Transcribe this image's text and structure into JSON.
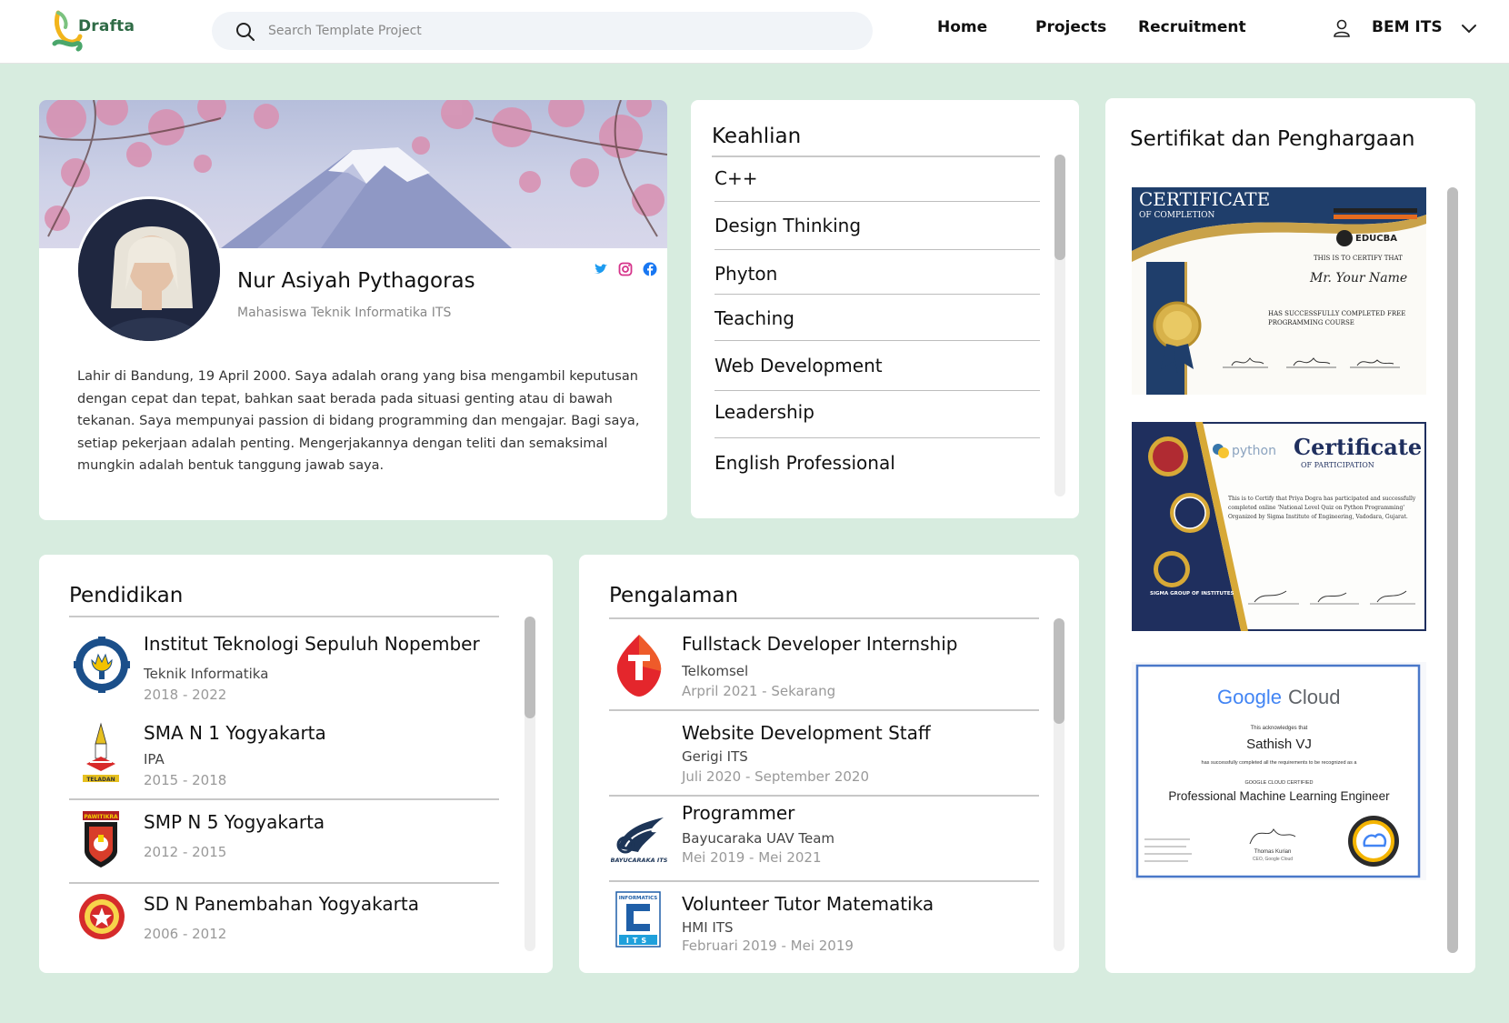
{
  "nav": {
    "logo_text": "Drafta",
    "search_placeholder": "Search Template Project",
    "links": [
      "Home",
      "Projects",
      "Recruitment"
    ],
    "user_name": "BEM ITS"
  },
  "profile": {
    "name": "Nur Asiyah Pythagoras",
    "role": "Mahasiswa Teknik Informatika ITS",
    "bio": "Lahir di Bandung, 19 April 2000. Saya adalah orang yang bisa mengambil keputusan dengan cepat dan tepat, bahkan saat berada pada situasi genting atau di bawah tekanan. Saya mempunyai passion di bidang programming dan mengajar. Bagi saya, setiap pekerjaan adalah penting. Mengerjakannya dengan teliti dan semaksimal mungkin adalah bentuk tanggung jawab saya.",
    "social_icons": [
      "twitter-icon",
      "instagram-icon",
      "facebook-icon"
    ]
  },
  "skills": {
    "title": "Keahlian",
    "items": [
      "C++",
      "Design Thinking",
      "Phyton",
      "Teaching",
      "Web Development",
      "Leadership",
      "English Professional"
    ]
  },
  "certificates": {
    "title": "Sertifikat dan Penghargaan",
    "items": [
      {
        "heading": "CERTIFICATE",
        "subheading": "OF COMPLETION",
        "issuer": "EDUCBA",
        "line1": "THIS IS TO CERTIFY THAT",
        "recipient": "Mr. Your Name",
        "line2": "HAS SUCCESSFULLY COMPLETED FREE",
        "line3": "PROGRAMMING COURSE"
      },
      {
        "issuer": "python",
        "heading": "Certificate",
        "subheading": "OF PARTICIPATION",
        "org": "SIGMA GROUP OF INSTITUTES",
        "body": "This is to Certify that Priya Dogra has participated and successfully completed online 'National Level Quiz on Python Programming' Organized by Sigma Institute of Engineering, Vadodara, Gujarat."
      },
      {
        "brand_google": "Google",
        "brand_cloud": "Cloud",
        "ack": "This acknowledges that",
        "recipient": "Sathish VJ",
        "line": "has successfully completed all the requirements to be recognized as a",
        "certified": "GOOGLE CLOUD CERTIFIED",
        "title": "Professional Machine Learning Engineer",
        "signer": "Thomas Kurian",
        "signer_title": "CEO, Google Cloud"
      }
    ]
  },
  "education": {
    "title": "Pendidikan",
    "items": [
      {
        "name": "Institut Teknologi Sepuluh Nopember",
        "major": "Teknik Informatika",
        "years": "2018 - 2022"
      },
      {
        "name": "SMA N 1 Yogyakarta",
        "major": "IPA",
        "years": "2015 - 2018"
      },
      {
        "name": "SMP N 5 Yogyakarta",
        "major": "",
        "years": "2012 - 2015"
      },
      {
        "name": "SD N Panembahan Yogyakarta",
        "major": "",
        "years": "2006 - 2012"
      }
    ],
    "logo_texts": [
      "TELADAN",
      "PAWITIKRA"
    ]
  },
  "experience": {
    "title": "Pengalaman",
    "items": [
      {
        "role": "Fullstack Developer Internship",
        "org": "Telkomsel",
        "period": "Arpril 2021 - Sekarang"
      },
      {
        "role": "Website Development Staff",
        "org": "Gerigi ITS",
        "period": "Juli 2020 - September 2020"
      },
      {
        "role": "Programmer",
        "org": "Bayucaraka UAV Team",
        "period": "Mei 2019 - Mei 2021"
      },
      {
        "role": "Volunteer Tutor Matematika",
        "org": "HMI ITS",
        "period": "Februari 2019 - Mei 2019"
      }
    ],
    "logo_texts": [
      "BAYUCARAKA ITS",
      "INFORMATICS",
      "ITS"
    ]
  },
  "colors": {
    "background": "#d7ecdf",
    "card": "#ffffff",
    "brand_green": "#2f6b46",
    "telkomsel_red": "#e4262c",
    "text_muted": "#999999"
  }
}
